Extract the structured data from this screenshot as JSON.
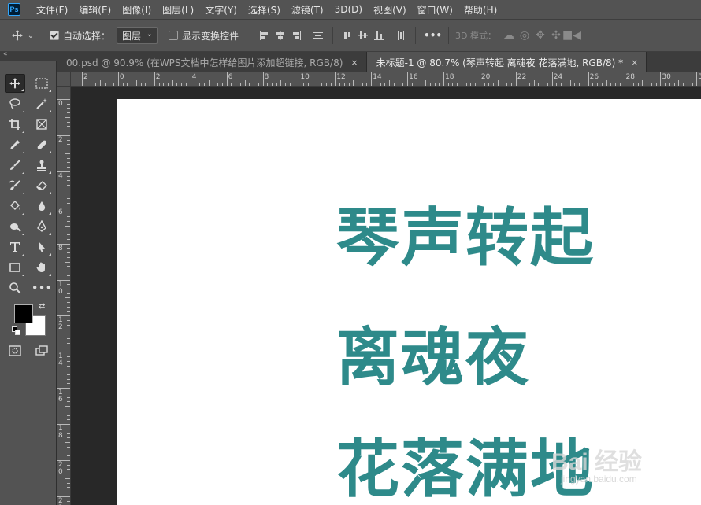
{
  "app": {
    "logo": "Ps"
  },
  "menu": [
    "文件(F)",
    "编辑(E)",
    "图像(I)",
    "图层(L)",
    "文字(Y)",
    "选择(S)",
    "滤镜(T)",
    "3D(D)",
    "视图(V)",
    "窗口(W)",
    "帮助(H)"
  ],
  "options": {
    "auto_select_label": "自动选择：",
    "auto_select_checked": true,
    "layer_select_value": "图层",
    "show_transform_label": "显示变换控件",
    "show_transform_checked": false,
    "more_label": "•••",
    "mode_3d_label": "3D 模式："
  },
  "tabs": [
    {
      "title": "00.psd @ 90.9% (在WPS文档中怎样给图片添加超链接, RGB/8)",
      "close": "×",
      "active": false
    },
    {
      "title": "未标题-1 @ 80.7% (琴声转起  离魂夜  花落满地, RGB/8) *",
      "close": "×",
      "active": true
    }
  ],
  "rulers": {
    "horizontal": [
      "2",
      "0",
      "2",
      "4",
      "6",
      "8",
      "10",
      "12",
      "14",
      "16",
      "18",
      "20",
      "22",
      "24",
      "26",
      "28",
      "30",
      "32"
    ],
    "vertical": [
      "0",
      "2",
      "4",
      "6",
      "8",
      "1\n0",
      "1\n2",
      "1\n4",
      "1\n6",
      "1\n8",
      "2\n0",
      "2\n2"
    ]
  },
  "canvas": {
    "text_color": "#2e8a8a",
    "lines": [
      "琴声转起",
      "离魂夜",
      "花落满地"
    ]
  },
  "watermark": {
    "text": "Bai 经验",
    "sub": "jingyan.baidu.com"
  },
  "colors": {
    "foreground": "#000000",
    "background": "#ffffff"
  }
}
